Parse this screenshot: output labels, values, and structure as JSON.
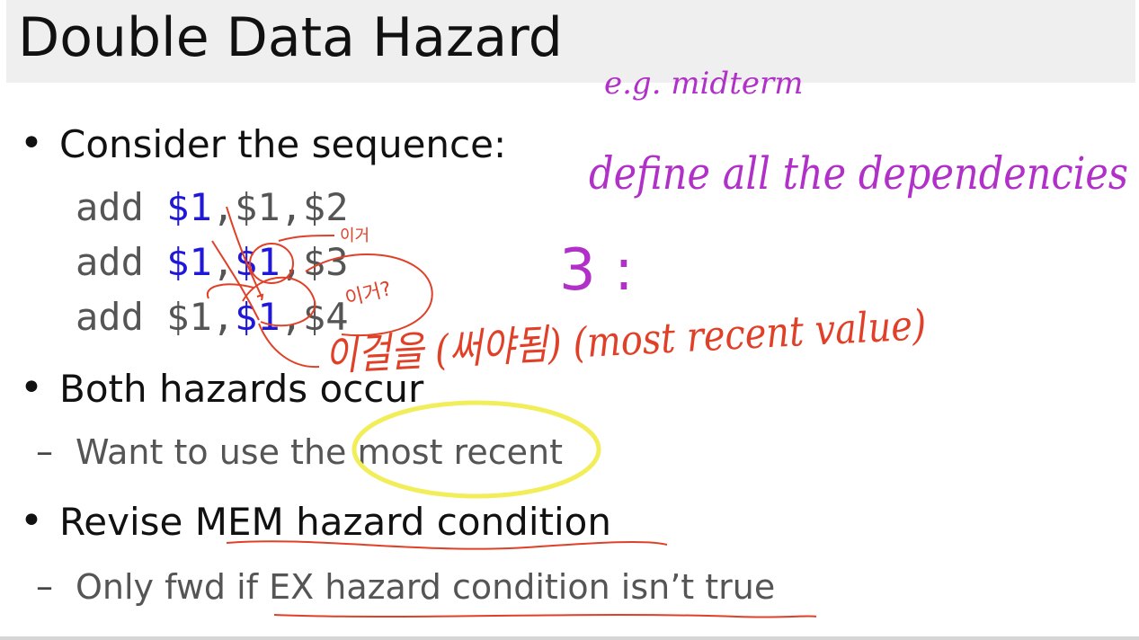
{
  "slide": {
    "title": "Double Data Hazard",
    "bullets": [
      {
        "text": "Consider the sequence:"
      },
      {
        "text": "Both hazards occur"
      },
      {
        "text": "Revise MEM hazard condition"
      }
    ],
    "subbullets": [
      {
        "text": "Want to use the most recent"
      },
      {
        "text": "Only fwd if EX hazard condition isn’t true"
      }
    ],
    "bullet_glyph": "•",
    "dash_glyph": "–",
    "code_lines": [
      {
        "op": "add",
        "rd": "$1",
        "rs": "$1",
        "rt": "$2",
        "sep1": ",",
        "sep2": ","
      },
      {
        "op": "add",
        "rd": "$1",
        "rs": "$1",
        "rt": "$3",
        "sep1": ",",
        "sep2": ","
      },
      {
        "op": "add",
        "rd": "$1",
        "rs": "$1",
        "rt": "$4",
        "sep1": ",",
        "sep2": ","
      }
    ],
    "colors": {
      "register_highlight": "#1f18d8",
      "pen_purple": "#b030c8",
      "pen_red": "#e04028",
      "highlighter_yellow": "#f2ee5a"
    }
  },
  "handwriting": {
    "purple_line1": "e.g. midterm",
    "purple_line2": "define all the dependencies",
    "three_note": "3 :",
    "red_note_1": "이거",
    "red_note_2": "이거?",
    "red_note_main": "이걸을 (써야됨) (most recent value)"
  }
}
